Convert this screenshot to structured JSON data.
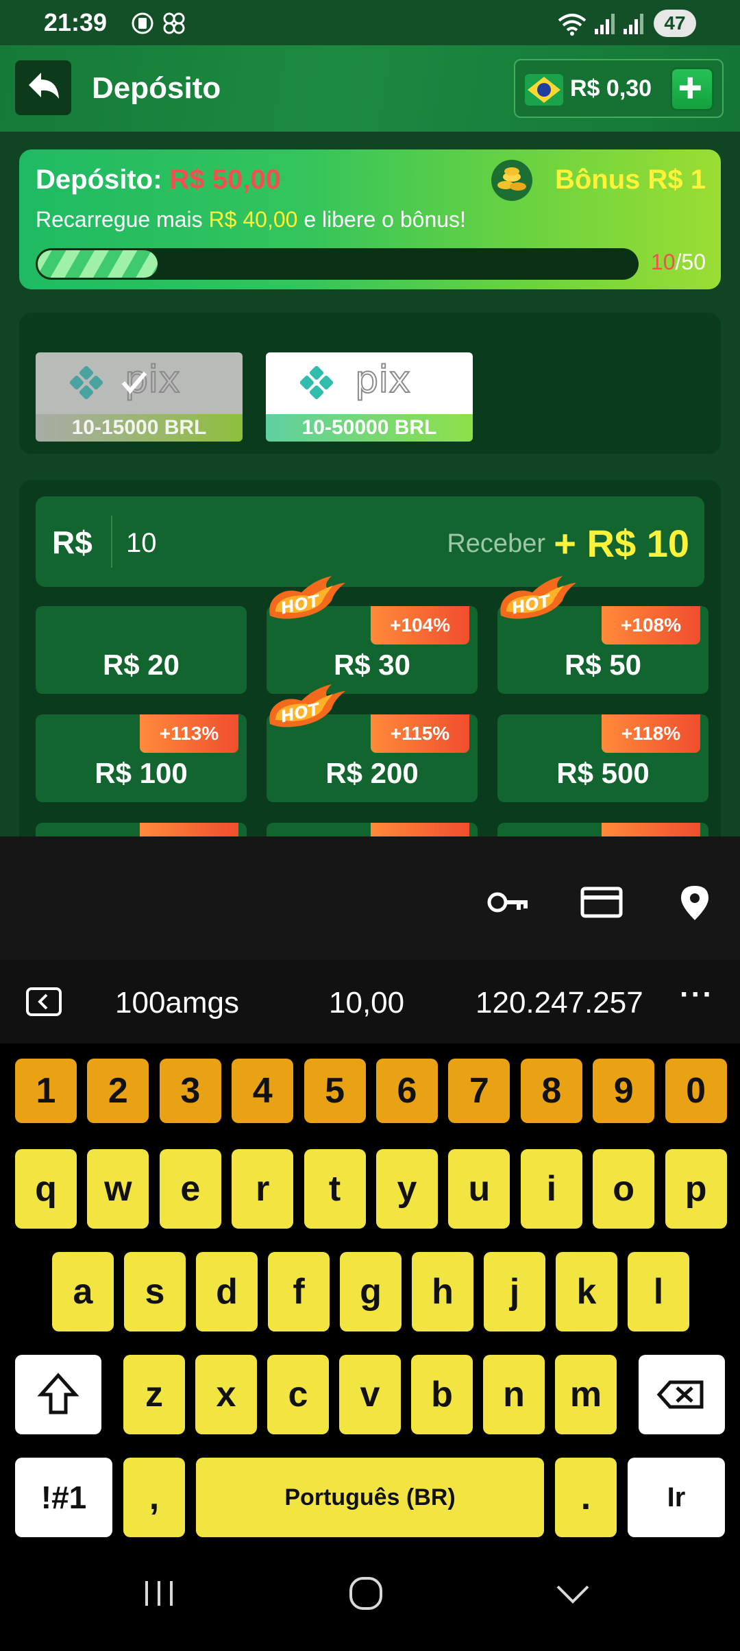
{
  "status_bar": {
    "time": "21:39",
    "battery": "47"
  },
  "header": {
    "title": "Depósito",
    "balance": "R$ 0,30"
  },
  "bonus": {
    "deposit_label": "Depósito:",
    "deposit_amount": "R$ 50,00",
    "bonus_text": "Bônus R$ 1",
    "sub_prefix": "Recarregue mais ",
    "sub_amount": "R$ 40,00",
    "sub_suffix": " e libere o bônus!",
    "progress_current": "10",
    "progress_total": "/50",
    "progress_fraction": 0.2
  },
  "payment_methods": [
    {
      "name": "pix",
      "range": "10-15000 BRL",
      "selected": true
    },
    {
      "name": "pix",
      "range": "10-50000 BRL",
      "selected": false
    }
  ],
  "amount": {
    "currency": "R$",
    "value": "10",
    "receive_label": "Receber",
    "receive_value": "+ R$ 10"
  },
  "amount_options": [
    {
      "label": "R$ 20",
      "bonus": "",
      "hot": false
    },
    {
      "label": "R$ 30",
      "bonus": "+104%",
      "hot": true
    },
    {
      "label": "R$ 50",
      "bonus": "+108%",
      "hot": true
    },
    {
      "label": "R$ 100",
      "bonus": "+113%",
      "hot": false
    },
    {
      "label": "R$ 200",
      "bonus": "+115%",
      "hot": true
    },
    {
      "label": "R$ 500",
      "bonus": "+118%",
      "hot": false
    }
  ],
  "keyboard": {
    "suggestions": [
      "100amgs",
      "10,00",
      "120.247.257"
    ],
    "more": "···",
    "number_row": [
      "1",
      "2",
      "3",
      "4",
      "5",
      "6",
      "7",
      "8",
      "9",
      "0"
    ],
    "row1": [
      "q",
      "w",
      "e",
      "r",
      "t",
      "y",
      "u",
      "i",
      "o",
      "p"
    ],
    "row2": [
      "a",
      "s",
      "d",
      "f",
      "g",
      "h",
      "j",
      "k",
      "l"
    ],
    "row3": [
      "z",
      "x",
      "c",
      "v",
      "b",
      "n",
      "m"
    ],
    "symbols": "!#1",
    "comma": ",",
    "space": "Português (BR)",
    "period": ".",
    "go": "Ir"
  },
  "colors": {
    "brand_green": "#157a37",
    "accent_yellow": "#fff23a",
    "accent_red": "#f25050",
    "key_yellow": "#f2e542",
    "key_orange": "#e8a214"
  }
}
